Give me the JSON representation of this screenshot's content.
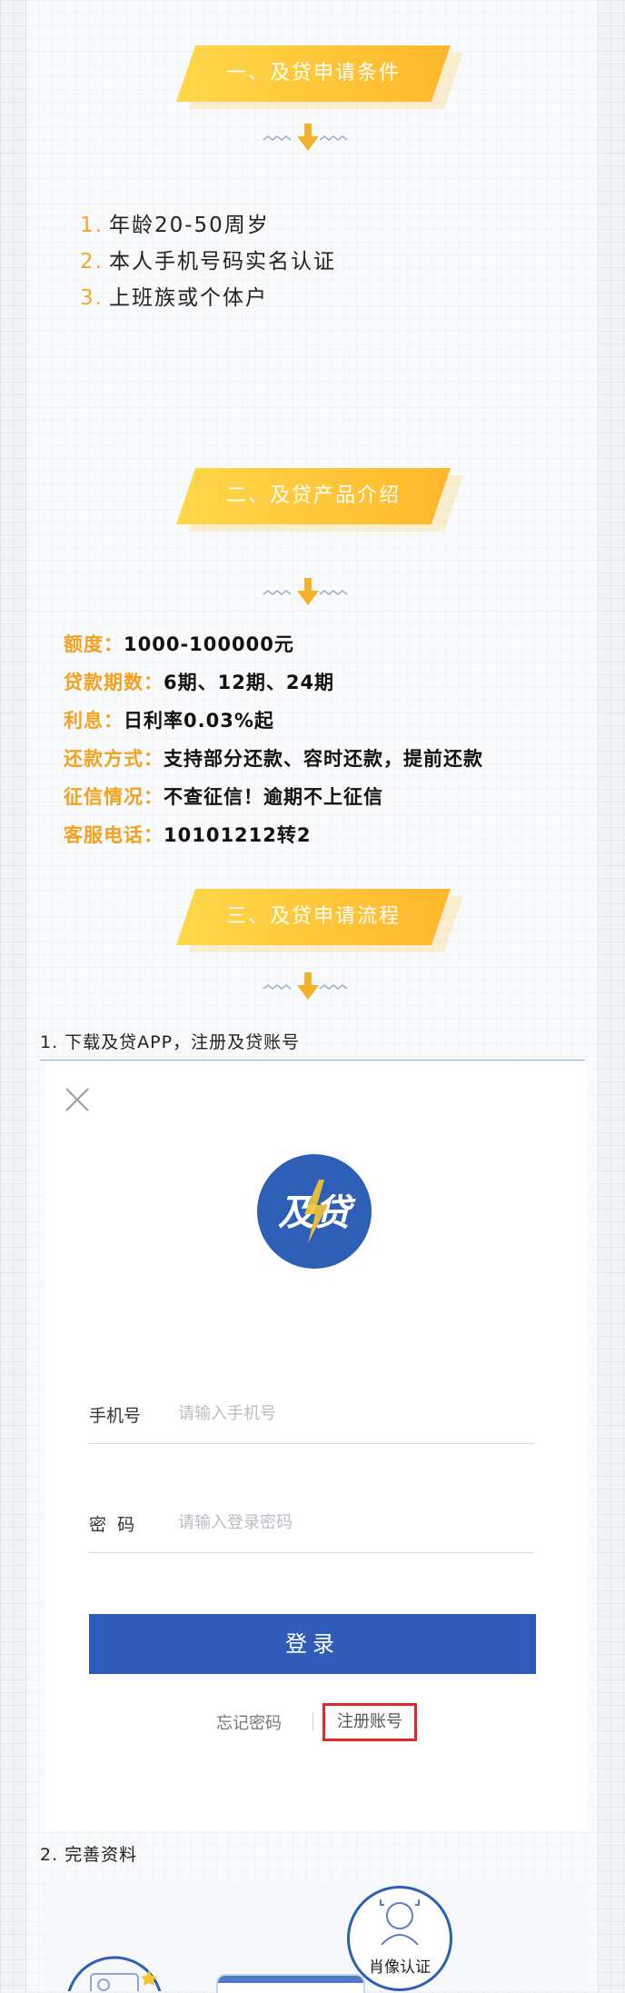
{
  "sections": {
    "conditions": {
      "title": "一、及贷申请条件"
    },
    "product": {
      "title": "二、及贷产品介绍"
    },
    "process": {
      "title": "三、及贷申请流程"
    }
  },
  "conditions": [
    {
      "num": "1.",
      "text": "年龄20-50周岁"
    },
    {
      "num": "2.",
      "text": "本人手机号码实名认证"
    },
    {
      "num": "3.",
      "text": "上班族或个体户"
    }
  ],
  "product": [
    {
      "label": "额度：",
      "value": "1000-100000元"
    },
    {
      "label": "贷款期数：",
      "value": "6期、12期、24期"
    },
    {
      "label": "利息：",
      "value": "日利率0.03%起"
    },
    {
      "label": "还款方式：",
      "value": "支持部分还款、容时还款，提前还款"
    },
    {
      "label": "征信情况：",
      "value": "不查征信！逾期不上征信"
    },
    {
      "label": "客服电话：",
      "value": "10101212转2"
    }
  ],
  "steps": {
    "step1": "1. 下载及贷APP，注册及贷账号",
    "step2": "2. 完善资料"
  },
  "login": {
    "logo_text": "及贷",
    "phone_label": "手机号",
    "phone_placeholder": "请输入手机号",
    "password_label": "密  码",
    "password_placeholder": "请输入登录密码",
    "login_button": "登录",
    "forgot_password": "忘记密码",
    "register": "注册账号"
  },
  "profile": {
    "avatar_badge": "肖像认证"
  },
  "colors": {
    "accent_yellow": "#f5a623",
    "banner_start": "#ffd84a",
    "banner_end": "#ffb72b",
    "primary_blue": "#2e5cb8",
    "highlight_red": "#e0262d"
  },
  "icons": {
    "close": "close-icon",
    "down_arrow": "down-arrow-icon",
    "logo": "lightning-logo-icon",
    "id_card": "id-card-icon",
    "avatar": "person-avatar-icon"
  }
}
